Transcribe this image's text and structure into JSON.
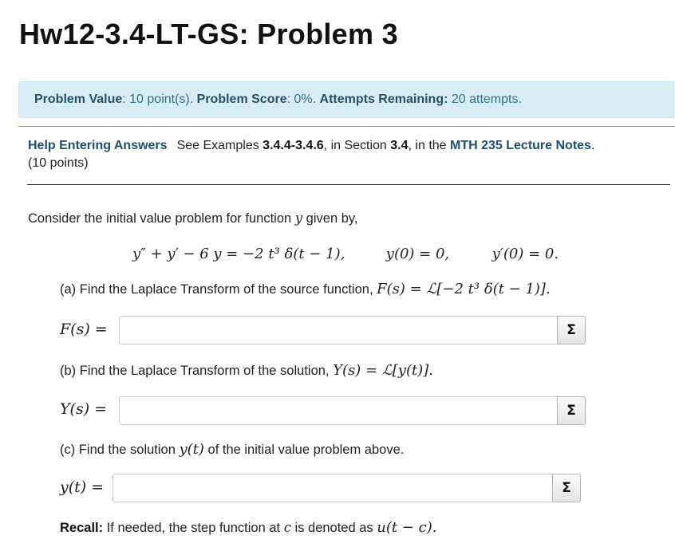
{
  "page_title": "Hw12-3.4-LT-GS: Problem 3",
  "status": {
    "value_label": "Problem Value",
    "value_text": ": 10 point(s).",
    "score_label": "Problem Score",
    "score_text": ": 0%.",
    "attempts_label": "Attempts Remaining:",
    "attempts_text": " 20 attempts."
  },
  "help": {
    "link_label": "Help Entering Answers",
    "t1": "See Examples ",
    "examples": "3.4.4-3.4.6",
    "t2": ", in Section ",
    "section": "3.4",
    "t3": ", in the ",
    "notes": "MTH 235 Lecture Notes",
    "t4": ".",
    "points": "(10 points)"
  },
  "problem": {
    "intro_a": "Consider the initial value problem for function ",
    "intro_var": "y",
    "intro_b": " given by,",
    "ode": "y″ + y′ − 6 y = −2 t³ δ(t − 1),",
    "ic1": "y(0) = 0,",
    "ic2": "y′(0) = 0.",
    "part_a_text": "(a) Find the Laplace Transform of the source function, ",
    "part_a_math": "F(s) = ℒ[−2 t³ δ(t − 1)].",
    "part_b_text": "(b) Find the Laplace Transform of the solution, ",
    "part_b_math": "Y(s) = ℒ[y(t)].",
    "part_c_a": "(c) Find the solution ",
    "part_c_math": "y(t)",
    "part_c_b": " of the initial value problem above.",
    "recall_label": "Recall:",
    "recall_text": " If needed, the step function at ",
    "recall_c": "c",
    "recall_text2": " is denoted as ",
    "recall_math": "u(t − c)."
  },
  "answers": [
    {
      "label": "F(s) =",
      "value": "",
      "button": "Σ"
    },
    {
      "label": "Y(s) =",
      "value": "",
      "button": "Σ"
    },
    {
      "label": "y(t) =",
      "value": "",
      "button": "Σ"
    }
  ]
}
